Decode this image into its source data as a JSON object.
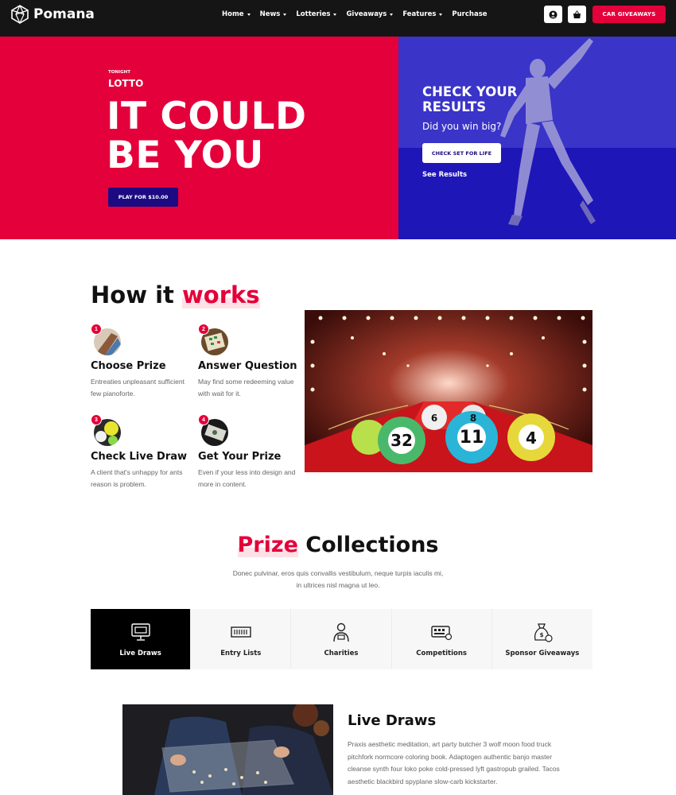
{
  "nav": {
    "logo_text": "Pomana",
    "menu": [
      {
        "label": "Home",
        "dropdown": true
      },
      {
        "label": "News",
        "dropdown": true
      },
      {
        "label": "Lotteries",
        "dropdown": true
      },
      {
        "label": "Giveaways",
        "dropdown": true
      },
      {
        "label": "Features",
        "dropdown": true
      },
      {
        "label": "Purchase",
        "dropdown": false
      }
    ],
    "account_icon": "user-icon",
    "cart_icon": "basket-icon",
    "cta_label": "CAR GIVEAWAYS"
  },
  "hero": {
    "eyebrow": "TONIGHT",
    "subtitle": "LOTTO",
    "title_line1": "IT COULD",
    "title_line2": "BE YOU",
    "play_button": "PLAY FOR $10.00",
    "side": {
      "title_line1": "CHECK YOUR",
      "title_line2": "RESULTS",
      "subtitle": "Did you win big?",
      "button": "CHECK SET FOR LIFE",
      "link": "See Results"
    }
  },
  "how": {
    "title_plain": "How it ",
    "title_highlight": "works",
    "steps": [
      {
        "num": "1",
        "title": "Choose Prize",
        "desc": "Entreaties unpleasant sufficient few pianoforte."
      },
      {
        "num": "2",
        "title": "Answer Question",
        "desc": "May find some redeeming value with wait for it."
      },
      {
        "num": "3",
        "title": "Check Live Draw",
        "desc": "A client that's unhappy for ants reason is problem."
      },
      {
        "num": "4",
        "title": "Get Your Prize",
        "desc": "Even if your less into design and more in content."
      }
    ],
    "ball_numbers": [
      "32",
      "11",
      "4",
      "6",
      "8"
    ]
  },
  "prize": {
    "title_highlight": "Prize",
    "title_plain": " Collections",
    "subtitle": "Donec pulvinar, eros quis convallis vestibulum, neque turpis iaculis mi, in ultrices nisl magna ut leo.",
    "tabs": [
      {
        "label": "Live Draws",
        "icon": "monitor-icon",
        "active": true
      },
      {
        "label": "Entry Lists",
        "icon": "ticket-icon",
        "active": false
      },
      {
        "label": "Charities",
        "icon": "person-icon",
        "active": false
      },
      {
        "label": "Competitions",
        "icon": "lottery-board-icon",
        "active": false
      },
      {
        "label": "Sponsor Giveaways",
        "icon": "money-bag-icon",
        "active": false
      }
    ]
  },
  "live_draws": {
    "title": "Live Draws",
    "text": "Praxis aesthetic meditation, art party butcher 3 wolf moon food truck pitchfork normcore coloring book. Adaptogen authentic banjo master cleanse synth four loko poke cold-pressed lyft gastropub grailed. Tacos aesthetic blackbird spyplane slow-carb kickstarter."
  },
  "colors": {
    "accent": "#e4003a",
    "navy": "#1c0a82",
    "hero_blue": "#3a34c8",
    "nav_bg": "#151515"
  }
}
